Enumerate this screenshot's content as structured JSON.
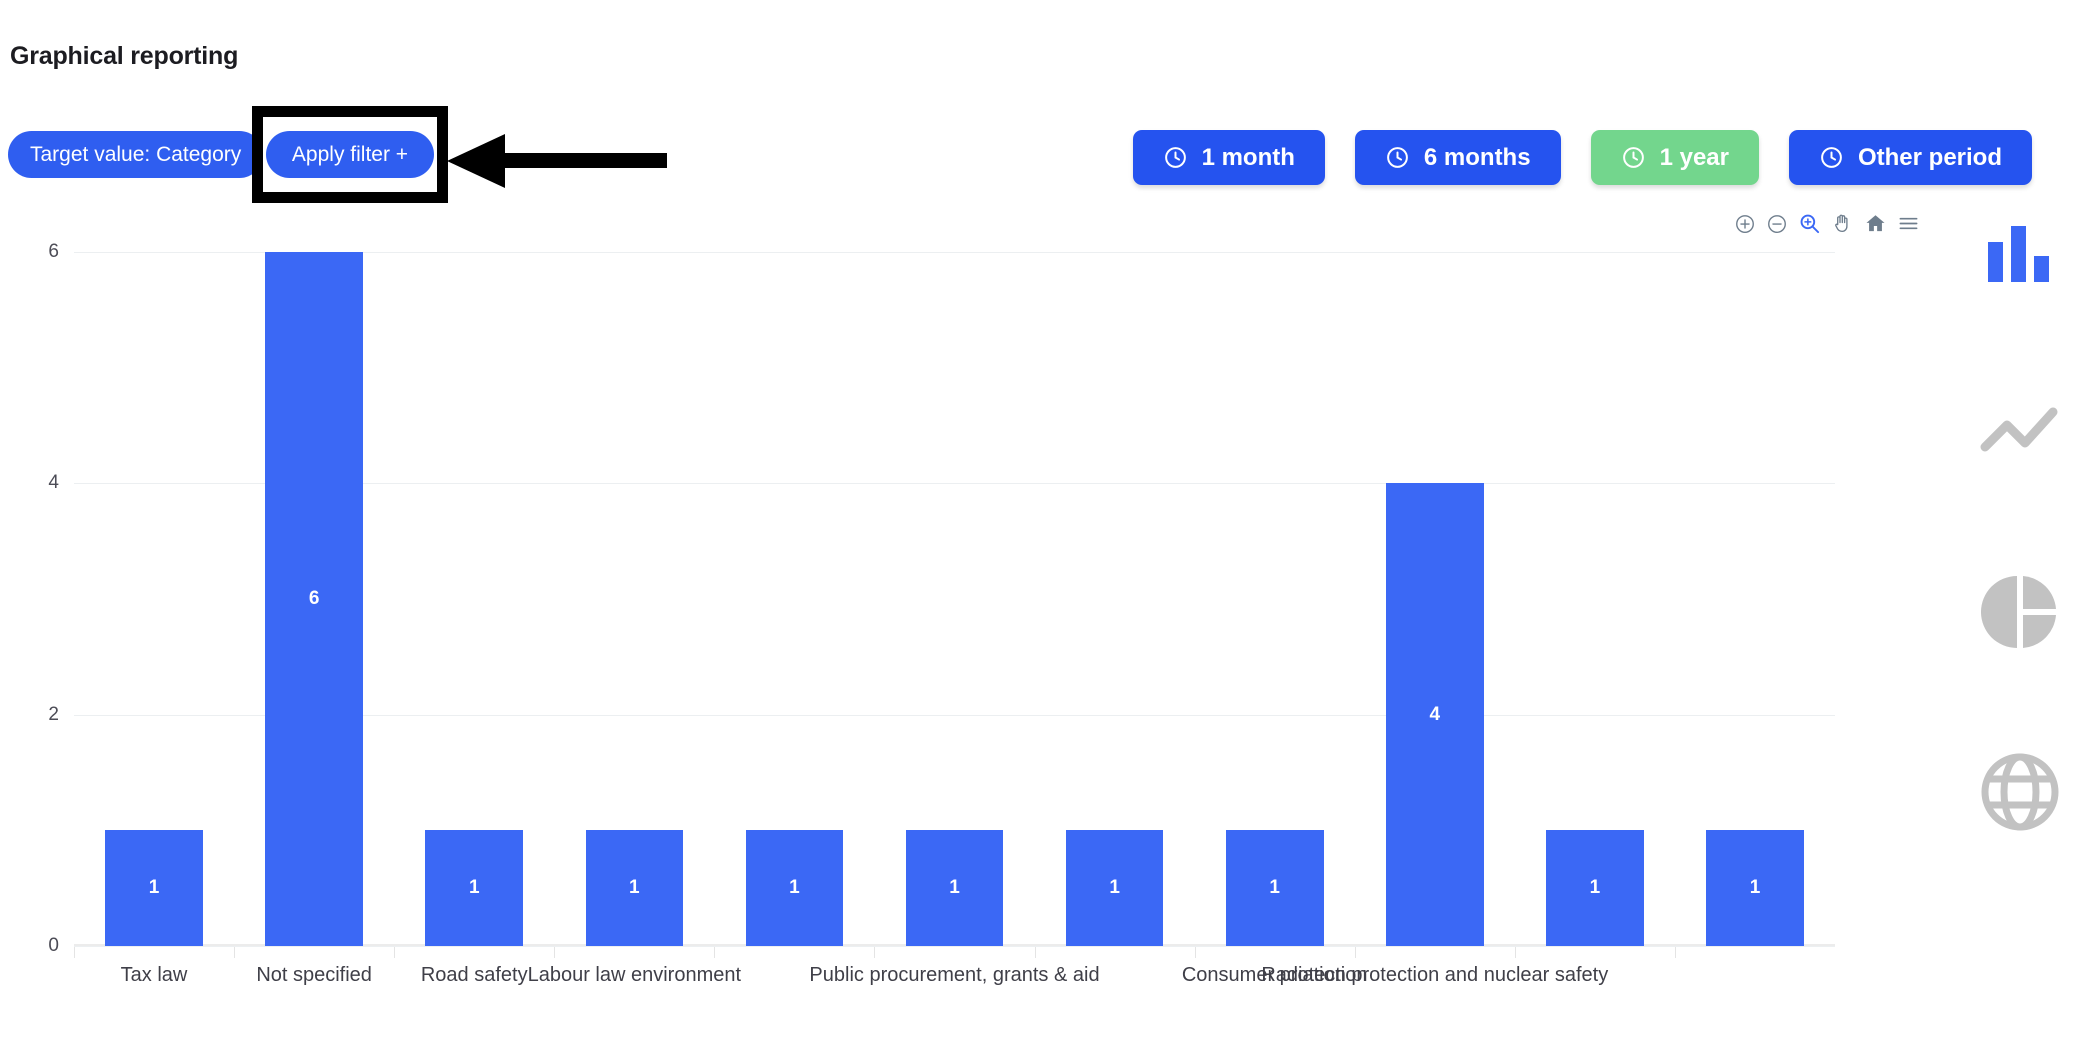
{
  "page": {
    "title": "Graphical reporting"
  },
  "filters": {
    "target_value_label": "Target value: Category",
    "apply_filter_label": "Apply filter +",
    "annotation": {
      "icon": "left-arrow-annotation",
      "highlight_target": "apply-filter-button"
    }
  },
  "periods": {
    "items": [
      {
        "label": "1 month",
        "icon": "clock-icon",
        "active": false,
        "color": "#2553ef"
      },
      {
        "label": "6 months",
        "icon": "clock-icon",
        "active": false,
        "color": "#2553ef"
      },
      {
        "label": "1 year",
        "icon": "clock-icon",
        "active": true,
        "color": "#73d68d"
      },
      {
        "label": "Other period",
        "icon": "clock-icon",
        "active": false,
        "color": "#2553ef"
      }
    ]
  },
  "chart_toolbar": {
    "items": [
      {
        "name": "zoom-in-icon",
        "active": false
      },
      {
        "name": "zoom-out-icon",
        "active": false
      },
      {
        "name": "selection-zoom-icon",
        "active": true
      },
      {
        "name": "panning-icon",
        "active": false
      },
      {
        "name": "reset-zoom-home-icon",
        "active": false
      },
      {
        "name": "menu-icon",
        "active": false
      }
    ],
    "active_color": "#3b68f5",
    "idle_color": "#6e7d8c"
  },
  "chart_types": {
    "items": [
      {
        "name": "bar-chart-icon",
        "active": true
      },
      {
        "name": "line-chart-icon",
        "active": false
      },
      {
        "name": "pie-chart-icon",
        "active": false
      },
      {
        "name": "globe-map-icon",
        "active": false
      }
    ],
    "active_color": "#3b68f5",
    "idle_color": "#c2c2c2"
  },
  "chart_data": {
    "type": "bar",
    "title": "",
    "xlabel": "",
    "ylabel": "",
    "ylim": [
      0,
      6
    ],
    "yticks": [
      0,
      2,
      4,
      6
    ],
    "grid": true,
    "legend": false,
    "bar_color": "#3b68f5",
    "categories": [
      "Tax law",
      "Not specified",
      "Road safety",
      "Labour law environment",
      "",
      "Public procurement, grants & aid",
      "",
      "Consumer protection",
      "Radiation protection and nuclear safety",
      "",
      ""
    ],
    "values": [
      1,
      6,
      1,
      1,
      1,
      1,
      1,
      1,
      4,
      1,
      1
    ],
    "data_labels": [
      "1",
      "6",
      "1",
      "1",
      "1",
      "1",
      "1",
      "1",
      "4",
      "1",
      "1"
    ],
    "visible_tick_labels": [
      {
        "text": "Tax law",
        "index": 0
      },
      {
        "text": "Not specified",
        "index": 1
      },
      {
        "text": "Road safety",
        "index": 2
      },
      {
        "text": "Labour law environment",
        "index": 3
      },
      {
        "text": "Public procurement, grants & aid",
        "index": 5
      },
      {
        "text": "Consumer protection",
        "index": 7
      },
      {
        "text": "Radiation protection and nuclear safety",
        "index": 8
      }
    ]
  }
}
